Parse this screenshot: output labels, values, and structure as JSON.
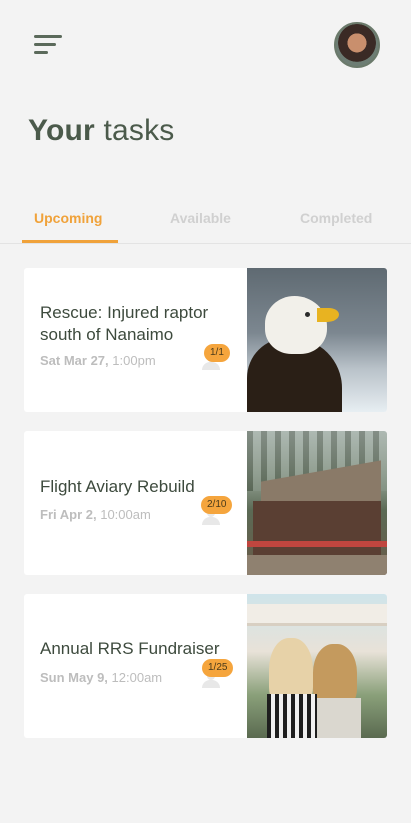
{
  "header": {
    "menu_icon": "hamburger-menu-icon",
    "avatar_icon": "user-avatar"
  },
  "page": {
    "title_bold": "Your",
    "title_light": "tasks"
  },
  "tabs": [
    {
      "label": "Upcoming",
      "active": true
    },
    {
      "label": "Available",
      "active": false
    },
    {
      "label": "Completed",
      "active": false
    }
  ],
  "tasks": [
    {
      "title": "Rescue: Injured raptor south of Nanaimo",
      "date": "Sat Mar 27,",
      "time": "1:00pm",
      "volunteers": "1/1",
      "image": "bald eagle photo"
    },
    {
      "title": "Flight Aviary Rebuild",
      "date": "Fri Apr 2,",
      "time": "10:00am",
      "volunteers": "2/10",
      "image": "collapsed aviary photo"
    },
    {
      "title": "Annual RRS Fundraiser",
      "date": "Sun May 9,",
      "time": "12:00am",
      "volunteers": "1/25",
      "image": "festival crowd photo"
    }
  ],
  "colors": {
    "accent": "#f0a23a",
    "title": "#4b5a4b",
    "muted": "#bdbdbd",
    "background": "#f3f3f3"
  }
}
